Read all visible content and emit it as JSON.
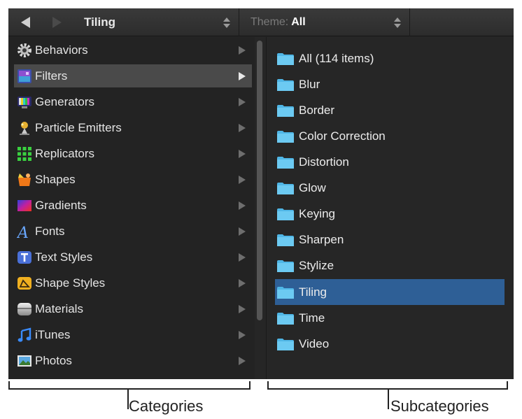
{
  "toolbar": {
    "folder_popup": "Tiling",
    "theme_prefix": "Theme:",
    "theme_value": "All"
  },
  "categories": [
    {
      "label": "Behaviors",
      "icon": "behaviors-gear-icon"
    },
    {
      "label": "Filters",
      "icon": "filters-icon",
      "selected": true
    },
    {
      "label": "Generators",
      "icon": "generators-icon"
    },
    {
      "label": "Particle Emitters",
      "icon": "particle-emitters-icon"
    },
    {
      "label": "Replicators",
      "icon": "replicators-icon"
    },
    {
      "label": "Shapes",
      "icon": "shapes-icon"
    },
    {
      "label": "Gradients",
      "icon": "gradients-icon"
    },
    {
      "label": "Fonts",
      "icon": "fonts-icon"
    },
    {
      "label": "Text Styles",
      "icon": "text-styles-icon"
    },
    {
      "label": "Shape Styles",
      "icon": "shape-styles-icon"
    },
    {
      "label": "Materials",
      "icon": "materials-icon"
    },
    {
      "label": "iTunes",
      "icon": "itunes-icon"
    },
    {
      "label": "Photos",
      "icon": "photos-icon"
    }
  ],
  "subcategories": [
    {
      "label": "All (114 items)"
    },
    {
      "label": "Blur"
    },
    {
      "label": "Border"
    },
    {
      "label": "Color Correction"
    },
    {
      "label": "Distortion"
    },
    {
      "label": "Glow"
    },
    {
      "label": "Keying"
    },
    {
      "label": "Sharpen"
    },
    {
      "label": "Stylize"
    },
    {
      "label": "Tiling",
      "selected": true
    },
    {
      "label": "Time"
    },
    {
      "label": "Video"
    }
  ],
  "callouts": {
    "categories": "Categories",
    "subcategories": "Subcategories"
  },
  "colors": {
    "panel_bg": "#262626",
    "selection_gray": "#4a4a4a",
    "selection_blue": "#2e5f96",
    "folder_blue": "#4fb6e6"
  }
}
